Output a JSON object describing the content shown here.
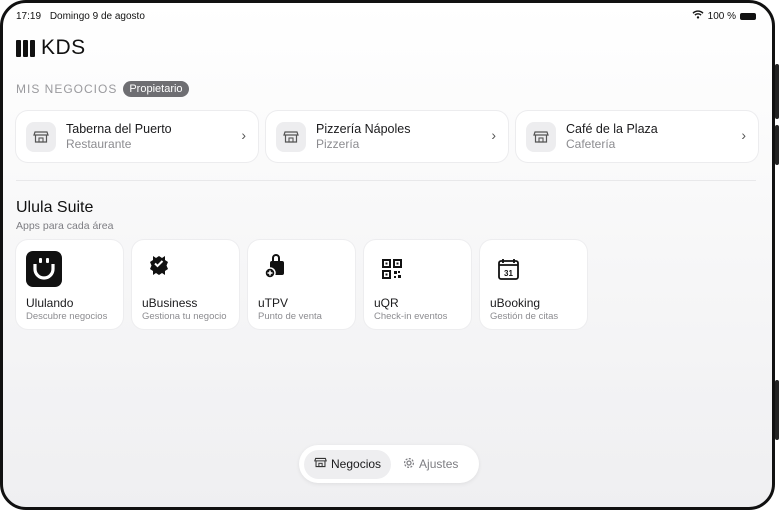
{
  "status_bar": {
    "time": "17:19",
    "date": "Domingo 9 de agosto",
    "battery": "100 %"
  },
  "header": {
    "app_name": "KDS"
  },
  "businesses": {
    "section_title": "MIS NEGOCIOS",
    "role_badge": "Propietario",
    "items": [
      {
        "name": "Taberna del Puerto",
        "type": "Restaurante"
      },
      {
        "name": "Pizzería Nápoles",
        "type": "Pizzería"
      },
      {
        "name": "Café de la Plaza",
        "type": "Cafetería"
      }
    ]
  },
  "suite": {
    "title": "Ulula Suite",
    "subtitle": "Apps para cada área",
    "apps": [
      {
        "name": "Ululando",
        "desc": "Descubre negocios",
        "icon": "ululando-logo-icon"
      },
      {
        "name": "uBusiness",
        "desc": "Gestiona tu negocio",
        "icon": "verified-badge-icon"
      },
      {
        "name": "uTPV",
        "desc": "Punto de venta",
        "icon": "shopping-bag-add-icon"
      },
      {
        "name": "uQR",
        "desc": "Check-in eventos",
        "icon": "qr-code-icon"
      },
      {
        "name": "uBooking",
        "desc": "Gestión de citas",
        "icon": "calendar-icon"
      }
    ],
    "calendar_day": "31"
  },
  "tabbar": {
    "tabs": [
      {
        "label": "Negocios",
        "icon": "store-icon",
        "active": true
      },
      {
        "label": "Ajustes",
        "icon": "gear-icon",
        "active": false
      }
    ]
  },
  "colors": {
    "accent_dark": "#111111",
    "badge_bg": "#6e6e72",
    "muted_text": "#8c8c90"
  }
}
